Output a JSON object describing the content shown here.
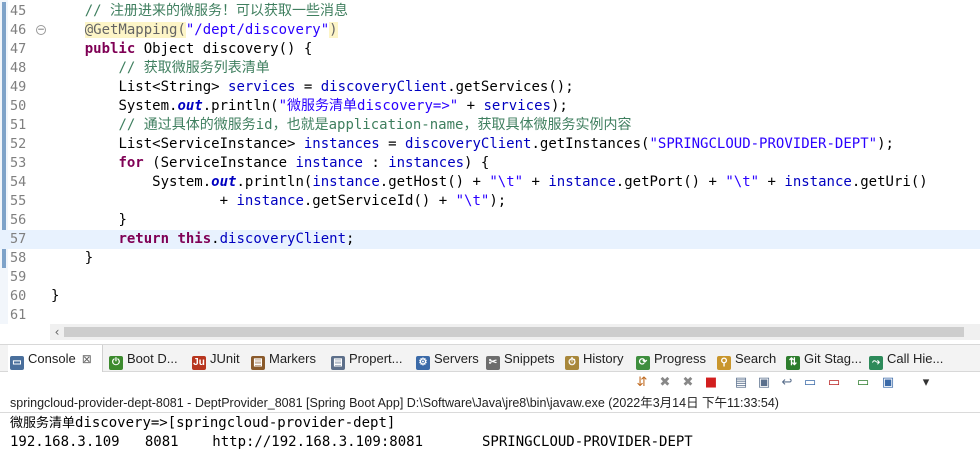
{
  "editor": {
    "lines": [
      {
        "num": "45",
        "fold": false,
        "current": false,
        "tokens": [
          [
            "ws",
            "    "
          ],
          [
            "cm",
            "// "
          ],
          [
            "cmcjk",
            "注册进来的微服务！可以获取一些消息"
          ]
        ]
      },
      {
        "num": "46",
        "fold": true,
        "current": false,
        "tokens": [
          [
            "ws",
            "    "
          ],
          [
            "annhl",
            "@GetMapping("
          ],
          [
            "str",
            "\"/dept/discovery\""
          ],
          [
            "annhl",
            ")"
          ]
        ]
      },
      {
        "num": "47",
        "fold": false,
        "current": false,
        "tokens": [
          [
            "ws",
            "    "
          ],
          [
            "kw",
            "public"
          ],
          [
            "t",
            " Object discovery() {"
          ]
        ]
      },
      {
        "num": "48",
        "fold": false,
        "current": false,
        "tokens": [
          [
            "ws",
            "        "
          ],
          [
            "cm",
            "// "
          ],
          [
            "cmcjk",
            "获取微服务列表清单"
          ]
        ]
      },
      {
        "num": "49",
        "fold": false,
        "current": false,
        "tokens": [
          [
            "ws",
            "        "
          ],
          [
            "t",
            "List<String> "
          ],
          [
            "fld",
            "services"
          ],
          [
            "t",
            " = "
          ],
          [
            "fld",
            "discoveryClient"
          ],
          [
            "t",
            ".getServices();"
          ]
        ]
      },
      {
        "num": "50",
        "fold": false,
        "current": false,
        "tokens": [
          [
            "ws",
            "        "
          ],
          [
            "t",
            "System."
          ],
          [
            "sfld",
            "out"
          ],
          [
            "t",
            ".println("
          ],
          [
            "str",
            "\""
          ],
          [
            "strcjk",
            "微服务清单"
          ],
          [
            "str",
            "discovery=>\""
          ],
          [
            "t",
            " + "
          ],
          [
            "fld",
            "services"
          ],
          [
            "t",
            ");"
          ]
        ]
      },
      {
        "num": "51",
        "fold": false,
        "current": false,
        "tokens": [
          [
            "ws",
            "        "
          ],
          [
            "cm",
            "// "
          ],
          [
            "cmcjk",
            "通过具体的微服务"
          ],
          [
            "cm",
            "id"
          ],
          [
            "cmcjk",
            "，也就是"
          ],
          [
            "cm",
            "application-name"
          ],
          [
            "cmcjk",
            "，获取具体微服务实例内容"
          ]
        ]
      },
      {
        "num": "52",
        "fold": false,
        "current": false,
        "tokens": [
          [
            "ws",
            "        "
          ],
          [
            "t",
            "List<ServiceInstance> "
          ],
          [
            "fld",
            "instances"
          ],
          [
            "t",
            " = "
          ],
          [
            "fld",
            "discoveryClient"
          ],
          [
            "t",
            ".getInstances("
          ],
          [
            "str",
            "\"SPRINGCLOUD-PROVIDER-DEPT\""
          ],
          [
            "t",
            ");"
          ]
        ]
      },
      {
        "num": "53",
        "fold": false,
        "current": false,
        "tokens": [
          [
            "ws",
            "        "
          ],
          [
            "kw",
            "for"
          ],
          [
            "t",
            " (ServiceInstance "
          ],
          [
            "fld",
            "instance"
          ],
          [
            "t",
            " : "
          ],
          [
            "fld",
            "instances"
          ],
          [
            "t",
            ") {"
          ]
        ]
      },
      {
        "num": "54",
        "fold": false,
        "current": false,
        "tokens": [
          [
            "ws",
            "            "
          ],
          [
            "t",
            "System."
          ],
          [
            "sfld",
            "out"
          ],
          [
            "t",
            ".println("
          ],
          [
            "fld",
            "instance"
          ],
          [
            "t",
            ".getHost() + "
          ],
          [
            "str",
            "\"\\t\""
          ],
          [
            "t",
            " + "
          ],
          [
            "fld",
            "instance"
          ],
          [
            "t",
            ".getPort() + "
          ],
          [
            "str",
            "\"\\t\""
          ],
          [
            "t",
            " + "
          ],
          [
            "fld",
            "instance"
          ],
          [
            "t",
            ".getUri()"
          ]
        ]
      },
      {
        "num": "55",
        "fold": false,
        "current": false,
        "tokens": [
          [
            "ws",
            "                    "
          ],
          [
            "t",
            "+ "
          ],
          [
            "fld",
            "instance"
          ],
          [
            "t",
            ".getServiceId() + "
          ],
          [
            "str",
            "\"\\t\""
          ],
          [
            "t",
            ");"
          ]
        ]
      },
      {
        "num": "56",
        "fold": false,
        "current": false,
        "tokens": [
          [
            "ws",
            "        "
          ],
          [
            "t",
            "}"
          ]
        ]
      },
      {
        "num": "57",
        "fold": false,
        "current": true,
        "tokens": [
          [
            "ws",
            "        "
          ],
          [
            "kw",
            "return"
          ],
          [
            "t",
            " "
          ],
          [
            "kw",
            "this"
          ],
          [
            "t",
            "."
          ],
          [
            "fld",
            "discoveryClient"
          ],
          [
            "t",
            ";"
          ]
        ]
      },
      {
        "num": "58",
        "fold": false,
        "current": false,
        "tokens": [
          [
            "ws",
            "    "
          ],
          [
            "t",
            "}"
          ]
        ]
      },
      {
        "num": "59",
        "fold": false,
        "current": false,
        "tokens": []
      },
      {
        "num": "60",
        "fold": false,
        "current": false,
        "tokens": [
          [
            "t",
            "}"
          ]
        ]
      },
      {
        "num": "61",
        "fold": false,
        "current": false,
        "tokens": []
      }
    ]
  },
  "views": {
    "tabs": [
      {
        "label": "Console",
        "icon": "console-icon",
        "active": true,
        "closable": true,
        "color": "#4a6f9c"
      },
      {
        "label": "Boot D...",
        "icon": "spring-boot-dashboard-icon",
        "active": false,
        "closable": false,
        "color": "#3c8a2e"
      },
      {
        "label": "JUnit",
        "icon": "junit-icon",
        "active": false,
        "closable": false,
        "color": "#b8361f"
      },
      {
        "label": "Markers",
        "icon": "markers-icon",
        "active": false,
        "closable": false,
        "color": "#8a5a2b"
      },
      {
        "label": "Propert...",
        "icon": "properties-icon",
        "active": false,
        "closable": false,
        "color": "#5d6f8a"
      },
      {
        "label": "Servers",
        "icon": "servers-icon",
        "active": false,
        "closable": false,
        "color": "#3b6aa8"
      },
      {
        "label": "Snippets",
        "icon": "snippets-icon",
        "active": false,
        "closable": false,
        "color": "#6d6d6d"
      },
      {
        "label": "History",
        "icon": "history-icon",
        "active": false,
        "closable": false,
        "color": "#a8873a"
      },
      {
        "label": "Progress",
        "icon": "progress-icon",
        "active": false,
        "closable": false,
        "color": "#3e8e3e"
      },
      {
        "label": "Search",
        "icon": "search-icon",
        "active": false,
        "closable": false,
        "color": "#c9962c"
      },
      {
        "label": "Git Stag...",
        "icon": "git-staging-icon",
        "active": false,
        "closable": false,
        "color": "#2d7d2d"
      },
      {
        "label": "Call Hie...",
        "icon": "call-hierarchy-icon",
        "active": false,
        "closable": false,
        "color": "#2d8a5a"
      }
    ]
  },
  "console": {
    "header": "springcloud-provider-dept-8081 - DeptProvider_8081 [Spring Boot App] D:\\Software\\Java\\jre8\\bin\\javaw.exe  (2022年3月14日 下午11:33:54)",
    "output": [
      [
        [
          "cjk",
          "微服务清单"
        ],
        [
          "t",
          "discovery=>[springcloud-provider-dept]"
        ]
      ],
      [
        [
          "t",
          "192.168.3.109   8081    http://192.168.3.109:8081       SPRINGCLOUD-PROVIDER-DEPT"
        ]
      ]
    ],
    "toolbar": [
      "pin-console-icon",
      "remove-launch-icon",
      "remove-all-terminated-icon",
      "terminate-icon",
      "clear-console-icon",
      "scroll-lock-icon",
      "word-wrap-icon",
      "show-when-stdout-icon",
      "show-when-stderr-icon",
      "display-selected-console-icon",
      "open-console-icon",
      "view-menu-icon"
    ]
  }
}
